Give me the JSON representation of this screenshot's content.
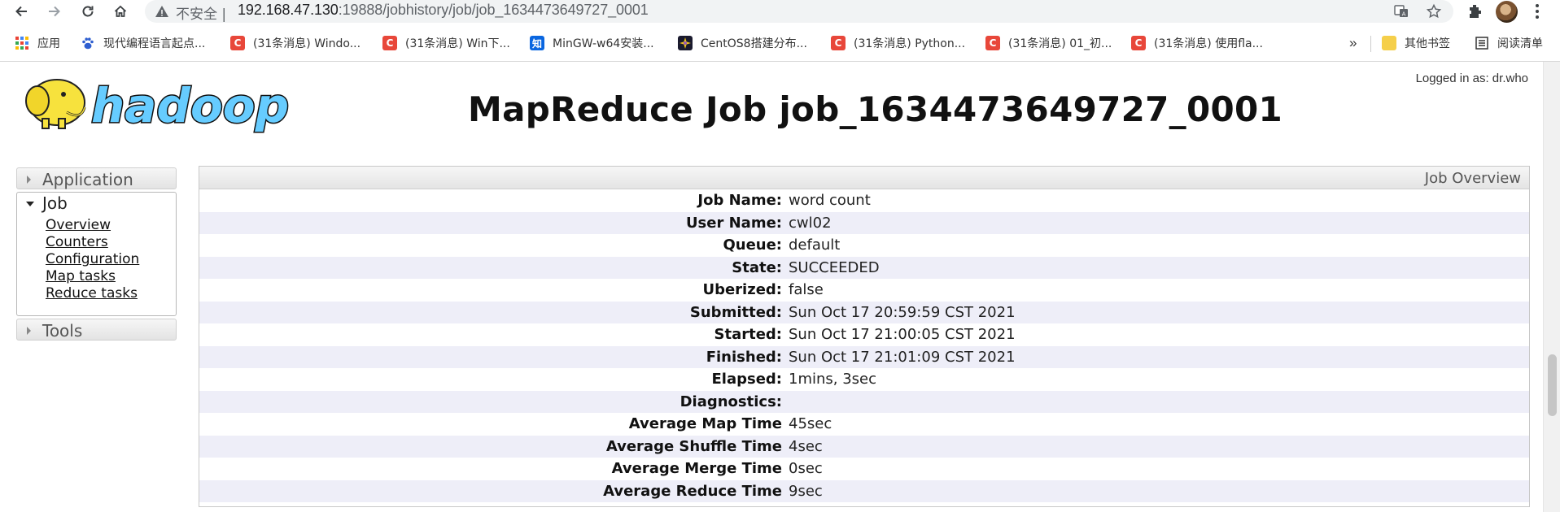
{
  "browser": {
    "insecure_label": "不安全",
    "url_host": "192.168.47.130",
    "url_rest": ":19888/jobhistory/job/job_1634473649727_0001",
    "bookmarks": [
      {
        "label": "应用",
        "icon": "apps-grid-icon"
      },
      {
        "label": "现代编程语言起点...",
        "icon": "paw-icon"
      },
      {
        "label": "(31条消息) Windo...",
        "icon": "csdn-icon"
      },
      {
        "label": "(31条消息) Win下...",
        "icon": "csdn-icon"
      },
      {
        "label": "MinGW-w64安装...",
        "icon": "zhihu-icon",
        "glyph": "知"
      },
      {
        "label": "CentOS8搭建分布...",
        "icon": "centos-icon"
      },
      {
        "label": "(31条消息) Python...",
        "icon": "csdn-icon"
      },
      {
        "label": "(31条消息) 01_初...",
        "icon": "csdn-icon"
      },
      {
        "label": "(31条消息) 使用fla...",
        "icon": "csdn-icon"
      }
    ],
    "more_chevron": "»",
    "other_bookmarks": "其他书签",
    "reading_list": "阅读清单",
    "csdn_glyph": "C"
  },
  "page": {
    "logged_in": "Logged in as: dr.who",
    "title": "MapReduce Job job_1634473649727_0001",
    "logo_text": "hadoop"
  },
  "sidebar": {
    "application": "Application",
    "job": "Job",
    "job_links": [
      "Overview",
      "Counters",
      "Configuration",
      "Map tasks",
      "Reduce tasks"
    ],
    "tools": "Tools"
  },
  "overview": {
    "caption": "Job Overview",
    "rows": [
      {
        "label": "Job Name:",
        "value": "word count"
      },
      {
        "label": "User Name:",
        "value": "cwl02"
      },
      {
        "label": "Queue:",
        "value": "default"
      },
      {
        "label": "State:",
        "value": "SUCCEEDED"
      },
      {
        "label": "Uberized:",
        "value": "false"
      },
      {
        "label": "Submitted:",
        "value": "Sun Oct 17 20:59:59 CST 2021"
      },
      {
        "label": "Started:",
        "value": "Sun Oct 17 21:00:05 CST 2021"
      },
      {
        "label": "Finished:",
        "value": "Sun Oct 17 21:01:09 CST 2021"
      },
      {
        "label": "Elapsed:",
        "value": "1mins, 3sec"
      },
      {
        "label": "Diagnostics:",
        "value": ""
      },
      {
        "label": "Average Map Time",
        "value": "45sec"
      },
      {
        "label": "Average Shuffle Time",
        "value": "4sec"
      },
      {
        "label": "Average Merge Time",
        "value": "0sec"
      },
      {
        "label": "Average Reduce Time",
        "value": "9sec"
      }
    ]
  },
  "colors": {
    "row_alt": "#eeeef8",
    "logo_yellow": "#f7e23d",
    "logo_blue": "#66ccff",
    "csdn_red": "#e8473a"
  }
}
